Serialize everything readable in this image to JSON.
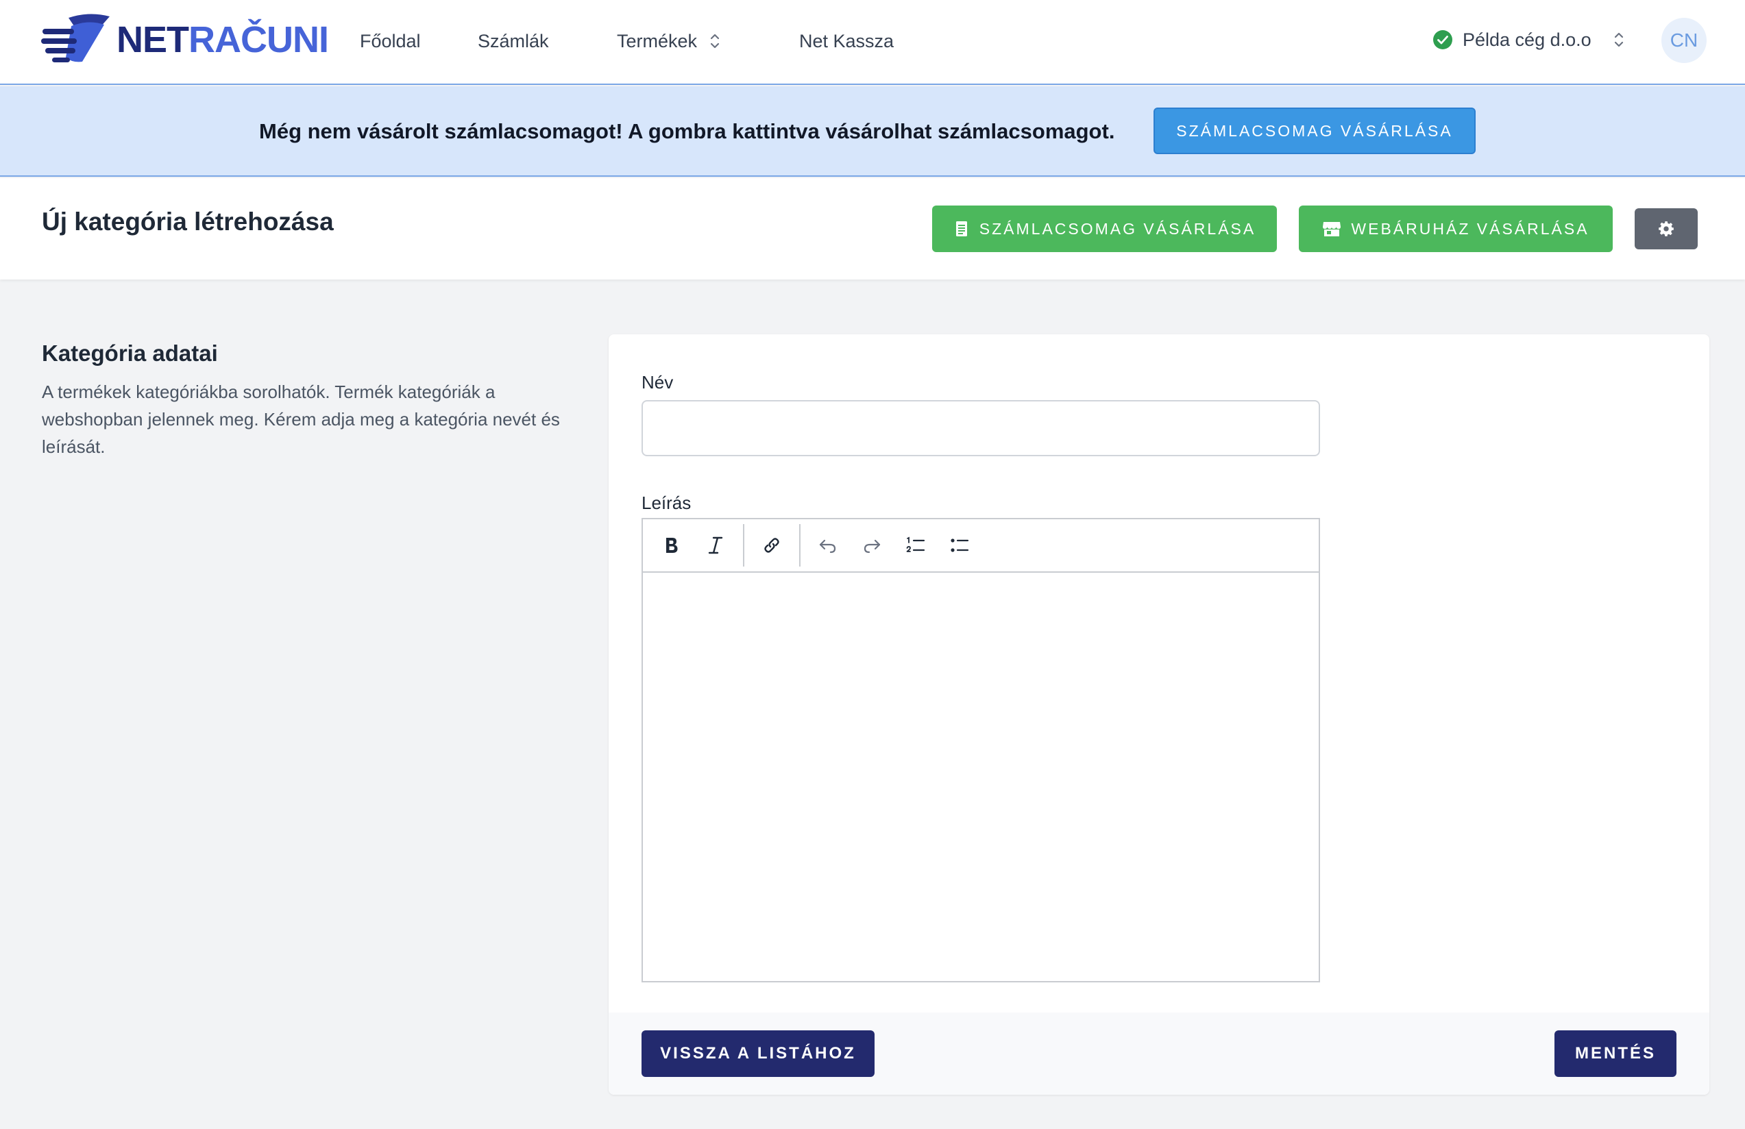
{
  "brand": {
    "name_part1": "NET",
    "name_part2": "RAČUNI"
  },
  "nav": {
    "items": [
      {
        "label": "Főoldal"
      },
      {
        "label": "Számlák"
      },
      {
        "label": "Termékek"
      },
      {
        "label": "Net Kassza"
      }
    ],
    "company": "Példa cég d.o.o",
    "avatar_initials": "CN"
  },
  "banner": {
    "message": "Még nem vásárolt számlacsomagot! A gombra kattintva vásárolhat számlacsomagot.",
    "button_label": "SZÁMLACSOMAG VÁSÁRLÁSA"
  },
  "header": {
    "title": "Új kategória létrehozása",
    "buy_invoice_package_label": "SZÁMLACSOMAG VÁSÁRLÁSA",
    "buy_webshop_label": "WEBÁRUHÁZ VÁSÁRLÁSA"
  },
  "section": {
    "title": "Kategória adatai",
    "description": "A termékek kategóriákba sorolhatók. Termék kategóriák a webshopban jelennek meg. Kérem adja meg a kategória nevét és leírását."
  },
  "form": {
    "name_label": "Név",
    "name_value": "",
    "description_label": "Leírás",
    "back_label": "VISSZA A LISTÁHOZ",
    "save_label": "MENTÉS"
  },
  "colors": {
    "primary_navy": "#232a6e",
    "success_green": "#4cb85c",
    "info_blue": "#3b97e3",
    "banner_bg": "#d7e6fb"
  }
}
